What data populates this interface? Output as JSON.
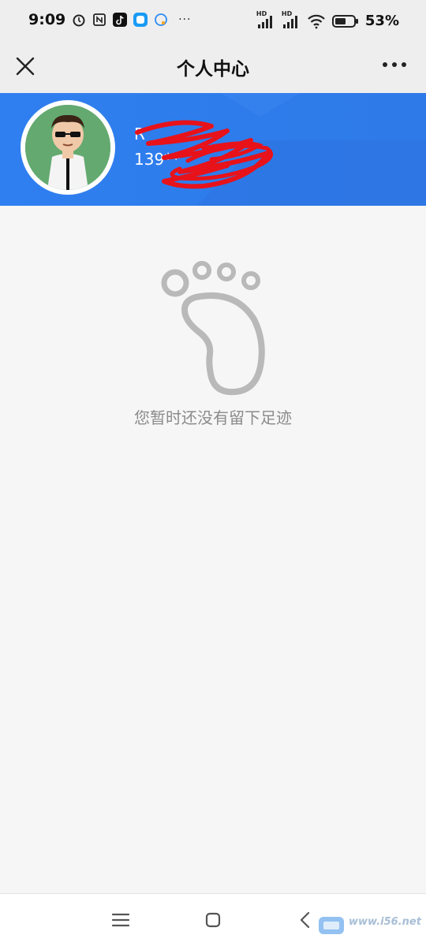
{
  "status": {
    "time": "9:09",
    "battery": "53%",
    "network_hd_1": "HD",
    "network_hd_2": "HD",
    "left_icons": [
      "alarm-icon",
      "nfc-icon",
      "tiktok-icon",
      "app-icon",
      "chat-icon"
    ],
    "more": "···"
  },
  "header": {
    "title": "个人中心"
  },
  "profile": {
    "name": "R",
    "phone": "139**"
  },
  "empty_state": {
    "message": "您暂时还没有留下足迹"
  },
  "nav": {
    "items": [
      "menu-icon",
      "home-icon",
      "back-icon"
    ]
  },
  "watermark": {
    "text": "www.i56.net"
  },
  "colors": {
    "header_blue": "#2f7ff0",
    "background": "#f6f6f6",
    "icon_gray": "#b8b8b8"
  }
}
